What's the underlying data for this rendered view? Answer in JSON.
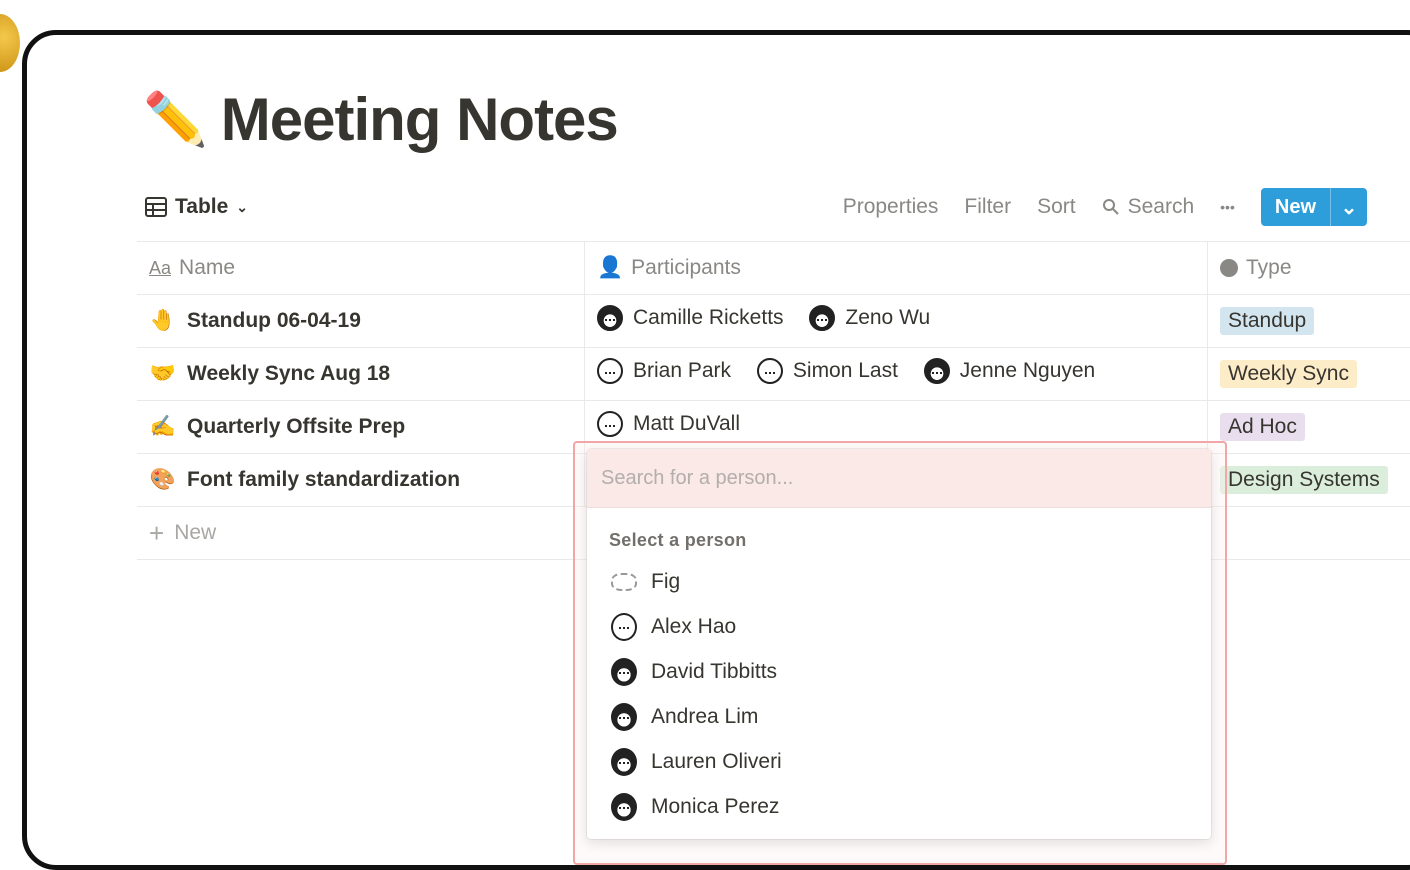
{
  "page": {
    "title": "Meeting Notes",
    "title_emoji": "✏️"
  },
  "toolbar": {
    "view_label": "Table",
    "properties": "Properties",
    "filter": "Filter",
    "sort": "Sort",
    "search": "Search",
    "more": "•••",
    "new_label": "New"
  },
  "table": {
    "headers": {
      "name": "Name",
      "name_icon": "Aa",
      "participants": "Participants",
      "type": "Type"
    },
    "rows": [
      {
        "emoji": "🤚",
        "name": "Standup 06-04-19",
        "participants": [
          "Camille Ricketts",
          "Zeno Wu"
        ],
        "type": "Standup",
        "type_color": "#d3e5ef"
      },
      {
        "emoji": "🤝",
        "name": "Weekly Sync Aug 18",
        "participants": [
          "Brian Park",
          "Simon Last",
          "Jenne Nguyen"
        ],
        "type": "Weekly Sync",
        "type_color": "#fdecc8"
      },
      {
        "emoji": "✍️",
        "name": "Quarterly Offsite Prep",
        "participants": [
          "Matt DuVall"
        ],
        "type": "Ad Hoc",
        "type_color": "#e8deee"
      },
      {
        "emoji": "🎨",
        "name": "Font family standardization",
        "participants": [],
        "type": "Design Systems",
        "type_color": "#dbeddb"
      }
    ],
    "new_row": "New"
  },
  "picker": {
    "placeholder": "Search for a person...",
    "section": "Select a person",
    "options": [
      "Fig",
      "Alex Hao",
      "David Tibbitts",
      "Andrea Lim",
      "Lauren Oliveri",
      "Monica Perez"
    ]
  },
  "colors": {
    "accent": "#2e9edb",
    "picker_border": "#f1a7a7"
  }
}
